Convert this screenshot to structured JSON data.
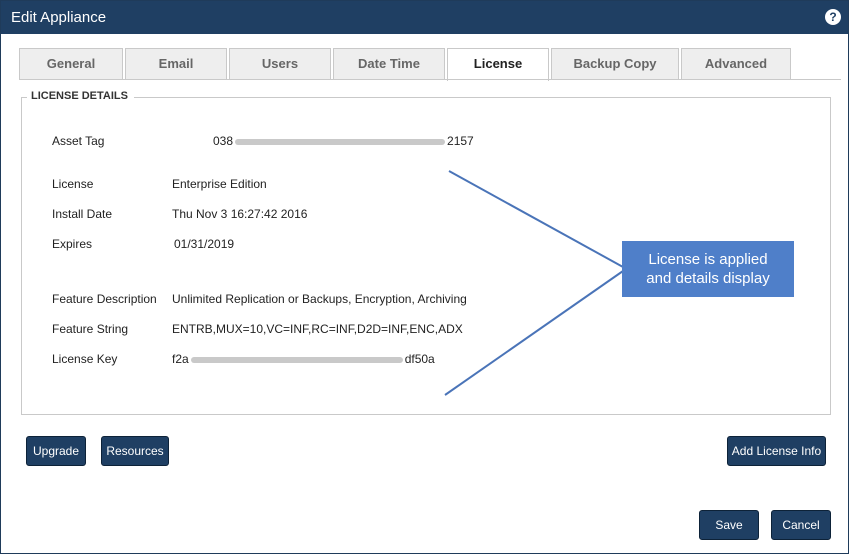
{
  "window": {
    "title": "Edit Appliance",
    "help_icon": "help-icon"
  },
  "tabs": [
    {
      "label": "General",
      "active": false
    },
    {
      "label": "Email",
      "active": false
    },
    {
      "label": "Users",
      "active": false
    },
    {
      "label": "Date Time",
      "active": false
    },
    {
      "label": "License",
      "active": true
    },
    {
      "label": "Backup Copy",
      "active": false
    },
    {
      "label": "Advanced",
      "active": false
    }
  ],
  "license_details": {
    "legend": "LICENSE DETAILS",
    "asset_tag": {
      "label": "Asset Tag",
      "value_start": "038",
      "value_end": "2157"
    },
    "license": {
      "label": "License",
      "value": "Enterprise Edition"
    },
    "install_date": {
      "label": "Install Date",
      "value": "Thu Nov 3 16:27:42 2016"
    },
    "expires": {
      "label": "Expires",
      "value": "01/31/2019"
    },
    "feature_description": {
      "label": "Feature Description",
      "value": "Unlimited Replication or Backups, Encryption, Archiving"
    },
    "feature_string": {
      "label": "Feature String",
      "value": "ENTRB,MUX=10,VC=INF,RC=INF,D2D=INF,ENC,ADX"
    },
    "license_key": {
      "label": "License Key",
      "value_start": "f2a",
      "value_end": "df50a"
    }
  },
  "callout": {
    "line1": "License is applied",
    "line2": "and details display",
    "color": "#4f7fc9"
  },
  "buttons": {
    "upgrade": "Upgrade",
    "resources": "Resources",
    "add_license_info": "Add License Info",
    "save": "Save",
    "cancel": "Cancel"
  },
  "colors": {
    "titlebar": "#1f3f63",
    "button": "#1f3f63",
    "arrow": "#4a74b8"
  }
}
